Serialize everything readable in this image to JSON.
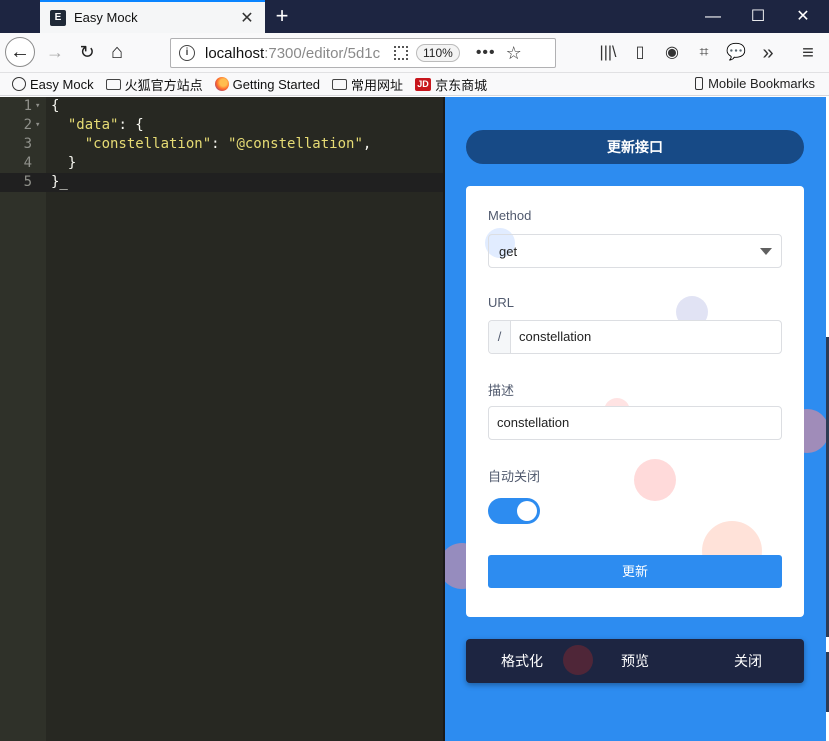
{
  "browser": {
    "tab": {
      "favicon": "E",
      "title": "Easy Mock",
      "close": "✕"
    },
    "new_tab": "+",
    "window_controls": {
      "minimize": "—",
      "maximize": "☐",
      "close": "✕"
    },
    "nav": {
      "back": "←",
      "forward": "→",
      "reload": "↻",
      "home": "⌂"
    },
    "url": {
      "host": "localhost",
      "rest": ":7300/editor/5d1c",
      "zoom": "110%",
      "more": "•••",
      "star": "☆"
    },
    "tools": {
      "library": "|||\\",
      "sidebar": "▯",
      "account": "◉",
      "crop": "⌗",
      "chat": "💬",
      "overflow": "»",
      "menu": "≡"
    },
    "bookmarks": [
      {
        "label": "Easy Mock",
        "icon": "globe-icon"
      },
      {
        "label": "火狐官方站点",
        "icon": "folder-icon"
      },
      {
        "label": "Getting Started",
        "icon": "firefox-icon"
      },
      {
        "label": "常用网址",
        "icon": "folder-icon"
      },
      {
        "label": "京东商城",
        "icon": "jd-icon"
      }
    ],
    "jd_icon_text": "JD",
    "mobile_bookmarks": "Mobile Bookmarks"
  },
  "editor": {
    "lines": [
      {
        "num": "1",
        "fold": "▾",
        "parts": [
          "{"
        ]
      },
      {
        "num": "2",
        "fold": "▾",
        "parts": [
          "  ",
          "\"data\"",
          ": {"
        ]
      },
      {
        "num": "3",
        "fold": "",
        "parts": [
          "    ",
          "\"constellation\"",
          ": ",
          "\"@constellation\"",
          ","
        ]
      },
      {
        "num": "4",
        "fold": "",
        "parts": [
          "  }"
        ]
      },
      {
        "num": "5",
        "fold": "",
        "parts": [
          "}_"
        ]
      }
    ]
  },
  "panel": {
    "update_api_label": "更新接口",
    "method_label": "Method",
    "method_value": "get",
    "url_label": "URL",
    "url_prefix": "/",
    "url_value": "constellation",
    "desc_label": "描述",
    "desc_value": "constellation",
    "autoclose_label": "自动关闭",
    "autoclose_on": true,
    "submit_label": "更新",
    "actions": {
      "format": "格式化",
      "preview": "预览",
      "close": "关闭"
    }
  }
}
